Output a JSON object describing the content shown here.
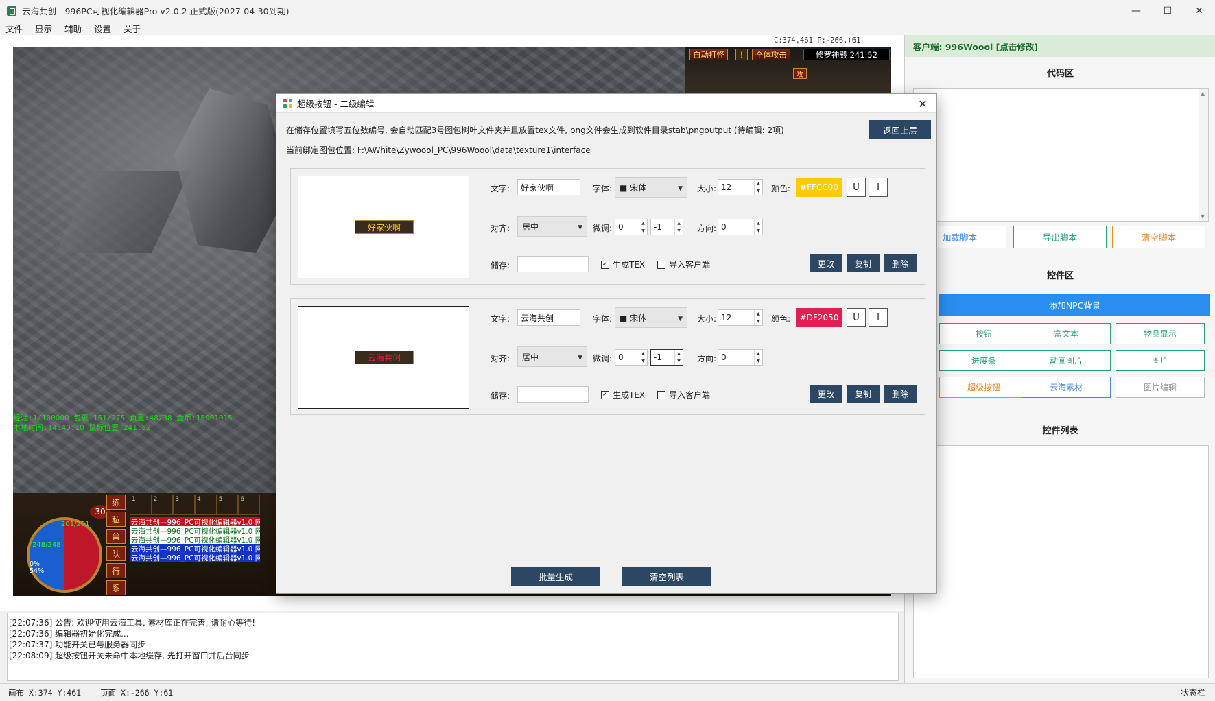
{
  "window": {
    "title": "云海共创—996PC可视化编辑器Pro v2.0.2 正式版(2027-04-30到期)",
    "minimize": "—",
    "maximize": "☐",
    "close": "✕"
  },
  "menu": [
    "文件",
    "显示",
    "辅助",
    "设置",
    "关于"
  ],
  "canvas": {
    "coords": "C:374,461   P:-266,+61"
  },
  "game": {
    "auto_fight": "自动打怪",
    "warn": "!",
    "all_attack": "全体攻击",
    "map_name": "修罗神殿  241:52",
    "attack_mode": "攻",
    "status_line1": "经验:1/100000 包裹:151/275 负重:48/38 金币:15901015",
    "status_line2": "本地时间:14:40:10 鼠标位置:241:52",
    "hp": "248/248",
    "mp": "201/201",
    "level": "30",
    "side_tabs": [
      "练",
      "私",
      "普",
      "队",
      "行",
      "系"
    ],
    "slots": [
      "1",
      "2",
      "3",
      "4",
      "5",
      "6"
    ],
    "chat_lines": [
      {
        "text": "云海共创—996_PC可视化编辑器v1.0 网",
        "style": "red"
      },
      {
        "text": "云海共创—996_PC可视化编辑器v1.0 网",
        "style": "white"
      },
      {
        "text": "云海共创—996_PC可视化编辑器v1.0 网",
        "style": "white"
      },
      {
        "text": "云海共创—996_PC可视化编辑器v1.0 网",
        "style": "blue"
      },
      {
        "text": "云海共创—996_PC可视化编辑器v1.0 网",
        "style": "blue"
      }
    ],
    "exp_percent": "0%\n54%"
  },
  "right_panel": {
    "client": "客户端: 996Woool [点击修改]",
    "code_title": "代码区",
    "load_script": "加载脚本",
    "export_script": "导出脚本",
    "clear_script": "清空脚本",
    "controls_title": "控件区",
    "add_npc_bg": "添加NPC背景",
    "controls": [
      {
        "label": "按钮",
        "color": "#2aa080"
      },
      {
        "label": "富文本",
        "color": "#2aa080"
      },
      {
        "label": "物品显示",
        "color": "#2aa080"
      },
      {
        "label": "进度条",
        "color": "#2aa080"
      },
      {
        "label": "动画图片",
        "color": "#2aa080"
      },
      {
        "label": "图片",
        "color": "#2aa080"
      },
      {
        "label": "超级按钮",
        "color": "#f08a2a"
      },
      {
        "label": "云海素材",
        "color": "#4a8ae0"
      },
      {
        "label": "图片编辑",
        "color": "#999999"
      }
    ],
    "list_title": "控件列表"
  },
  "log": [
    "[22:07:36] 公告: 欢迎使用云海工具, 素材库正在完善, 请耐心等待!",
    "[22:07:36] 编辑器初始化完成...",
    "[22:07:37] 功能开关已与服务器同步",
    "[22:08:09] 超级按钮开关未命中本地缓存, 先打开窗口并后台同步"
  ],
  "statusbar": {
    "canvas": "画布 X:374 Y:461",
    "page": "页面 X:-266 Y:61",
    "right": "状态栏"
  },
  "dialog": {
    "title": "超级按钮 - 二级编辑",
    "hint": "在储存位置填写五位数编号, 会自动匹配3号图包树叶文件夹并且放置tex文件, png文件会生成到软件目录stab\\pngoutput (待编辑: 2项)",
    "path": "当前绑定图包位置: F:\\AWhite\\Zywoool_PC\\996Woool\\data\\texture1\\interface",
    "back": "返回上层",
    "labels": {
      "text": "文字:",
      "font": "字体:",
      "size": "大小:",
      "color": "颜色:",
      "align": "对齐:",
      "tune": "微调:",
      "direction": "方向:",
      "storage": "储存:",
      "gen_tex": "生成TEX",
      "import_client": "导入客户端",
      "modify": "更改",
      "copy": "复制",
      "delete": "删除",
      "underline": "U",
      "italic": "I"
    },
    "items": [
      {
        "preview_text": "好家伙啊",
        "preview_color": "#FFCC00",
        "text": "好家伙啊",
        "font": "■ 宋体",
        "size": "12",
        "color": "#FFCC00",
        "align": "居中",
        "tune_x": "0",
        "tune_y": "-1",
        "direction": "0",
        "storage": "",
        "gen_tex": true,
        "import_client": false
      },
      {
        "preview_text": "云海共创",
        "preview_color": "#DF2050",
        "text": "云海共创",
        "font": "■ 宋体",
        "size": "12",
        "color": "#DF2050",
        "align": "居中",
        "tune_x": "0",
        "tune_y": "-1",
        "direction": "0",
        "storage": "",
        "gen_tex": true,
        "import_client": false
      }
    ],
    "batch_generate": "批量生成",
    "clear_list": "清空列表"
  }
}
